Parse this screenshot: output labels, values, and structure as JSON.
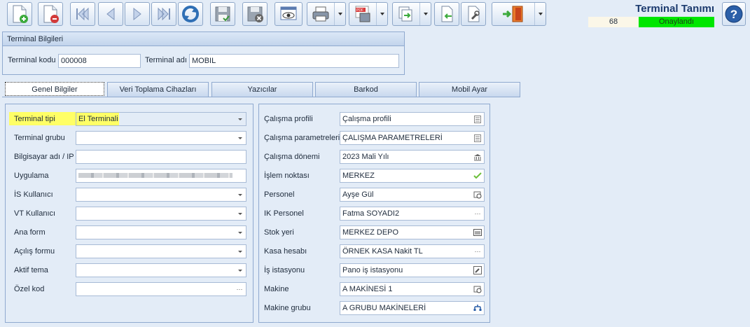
{
  "window": {
    "title": "Terminal Tanımı",
    "record_no": "68",
    "status": "Onaylandı"
  },
  "toolbar": {
    "buttons": [
      {
        "name": "new-record",
        "icon": "doc-plus-icon"
      },
      {
        "name": "delete-record",
        "icon": "doc-minus-icon"
      },
      {
        "name": "first-record",
        "icon": "first-arrow-icon"
      },
      {
        "name": "previous-record",
        "icon": "prev-arrow-icon"
      },
      {
        "name": "next-record",
        "icon": "next-arrow-icon"
      },
      {
        "name": "last-record",
        "icon": "last-arrow-icon"
      },
      {
        "name": "refresh",
        "icon": "refresh-icon"
      },
      {
        "name": "save",
        "icon": "save-icon"
      },
      {
        "name": "save-close",
        "icon": "save-close-icon"
      },
      {
        "name": "preview",
        "icon": "eye-icon"
      },
      {
        "name": "print",
        "icon": "printer-icon"
      },
      {
        "name": "export-pdf",
        "icon": "pdf-icon"
      },
      {
        "name": "transfer",
        "icon": "transfer-icon"
      },
      {
        "name": "import",
        "icon": "import-icon"
      },
      {
        "name": "tools",
        "icon": "wrench-icon"
      },
      {
        "name": "exit",
        "icon": "exit-door-icon"
      },
      {
        "name": "help",
        "icon": "help-icon"
      }
    ]
  },
  "header_group": {
    "title": "Terminal Bilgileri",
    "code_label": "Terminal kodu",
    "code_value": "000008",
    "name_label": "Terminal adı",
    "name_value": "MOBIL"
  },
  "tabs": [
    "Genel Bilgiler",
    "Veri Toplama Cihazları",
    "Yazıcılar",
    "Barkod",
    "Mobil Ayar"
  ],
  "left_fields": [
    {
      "label": "Terminal tipi",
      "value": "El Terminali",
      "type": "dropdown"
    },
    {
      "label": "Terminal grubu",
      "value": "",
      "type": "dropdown"
    },
    {
      "label": "Bilgisayar adı / IP",
      "value": "",
      "type": "text"
    },
    {
      "label": "Uygulama",
      "value": "",
      "type": "text"
    },
    {
      "label": "İS Kullanıcı",
      "value": "",
      "type": "dropdown"
    },
    {
      "label": "VT Kullanıcı",
      "value": "",
      "type": "dropdown"
    },
    {
      "label": "Ana form",
      "value": "",
      "type": "dropdown"
    },
    {
      "label": "Açılış formu",
      "value": "",
      "type": "dropdown"
    },
    {
      "label": "Aktif tema",
      "value": "",
      "type": "dropdown"
    },
    {
      "label": "Özel kod",
      "value": "",
      "type": "lookup"
    }
  ],
  "right_fields": [
    {
      "label": "Çalışma profili",
      "value": "Çalışma profili",
      "icon": "list-icon"
    },
    {
      "label": "Çalışma parametreleri",
      "value": "ÇALIŞMA PARAMETRELERİ",
      "icon": "list-icon"
    },
    {
      "label": "Çalışma dönemi",
      "value": "2023 Mali Yılı",
      "icon": "bank-icon"
    },
    {
      "label": "İşlem noktası",
      "value": "MERKEZ",
      "icon": "check-icon"
    },
    {
      "label": "Personel",
      "value": "Ayşe Gül",
      "icon": "person-icon"
    },
    {
      "label": "IK Personel",
      "value": "Fatma SOYADI2",
      "icon": "ellipsis-icon"
    },
    {
      "label": "Stok yeri",
      "value": "MERKEZ DEPO",
      "icon": "warehouse-icon"
    },
    {
      "label": "Kasa hesabı",
      "value": "ÖRNEK KASA Nakit TL",
      "icon": "ellipsis-icon"
    },
    {
      "label": "İş istasyonu",
      "value": "Pano iş istasyonu",
      "icon": "tools-icon"
    },
    {
      "label": "Makine",
      "value": "A MAKİNESİ 1",
      "icon": "machine-icon"
    },
    {
      "label": "Makine grubu",
      "value": "A GRUBU MAKİNELERİ",
      "icon": "group-icon"
    }
  ],
  "colors": {
    "status_bg": "#00e600",
    "highlight": "#ffff66",
    "title": "#1c3b6e"
  }
}
